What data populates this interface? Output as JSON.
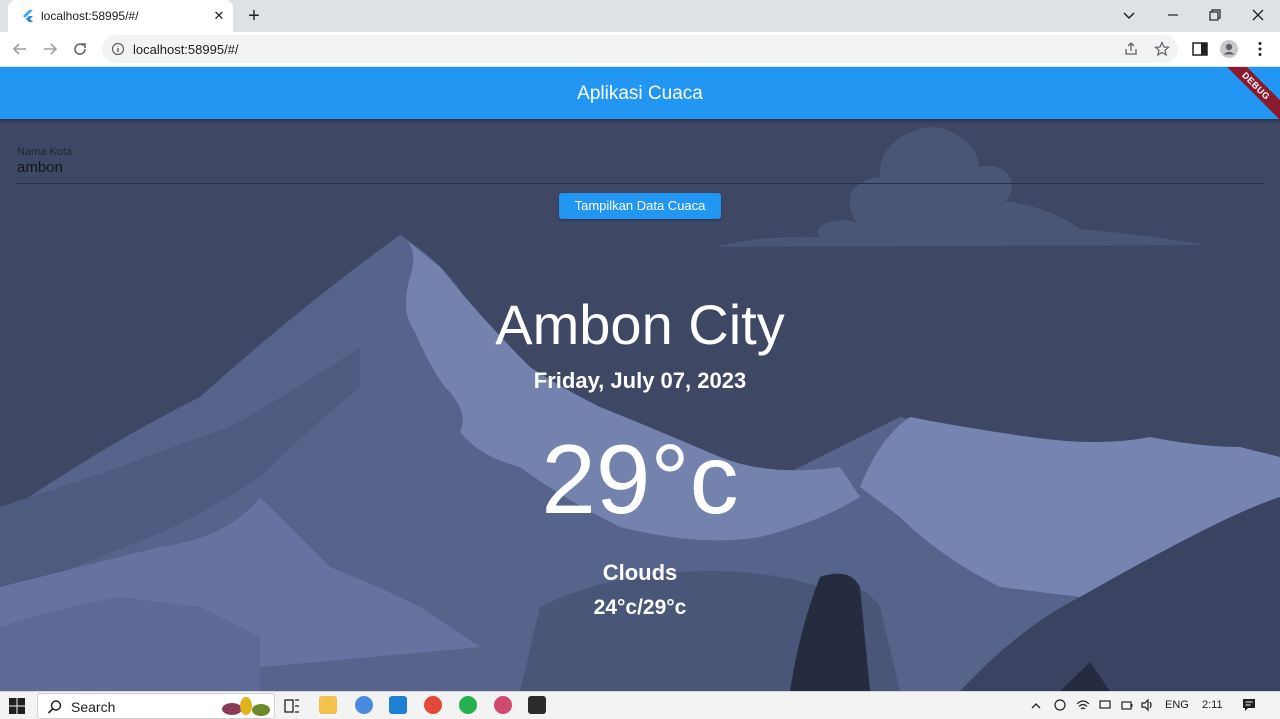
{
  "browser": {
    "tab_title": "localhost:58995/#/",
    "url": "localhost:58995/#/",
    "close_symbol": "✕",
    "new_tab_symbol": "+"
  },
  "app": {
    "title": "Aplikasi Cuaca",
    "debug_banner": "DEBUG",
    "input_label": "Nama Kota",
    "input_value": "ambon",
    "button_label": "Tampilkan Data Cuaca"
  },
  "weather": {
    "city": "Ambon City",
    "date": "Friday, July 07, 2023",
    "temperature": "29°c",
    "condition": "Clouds",
    "range": "24°c/29°c"
  },
  "taskbar": {
    "search_label": "Search",
    "language": "ENG",
    "time": "2:11"
  },
  "colors": {
    "appbar": "#2196f3",
    "background": "#3f4a68"
  }
}
